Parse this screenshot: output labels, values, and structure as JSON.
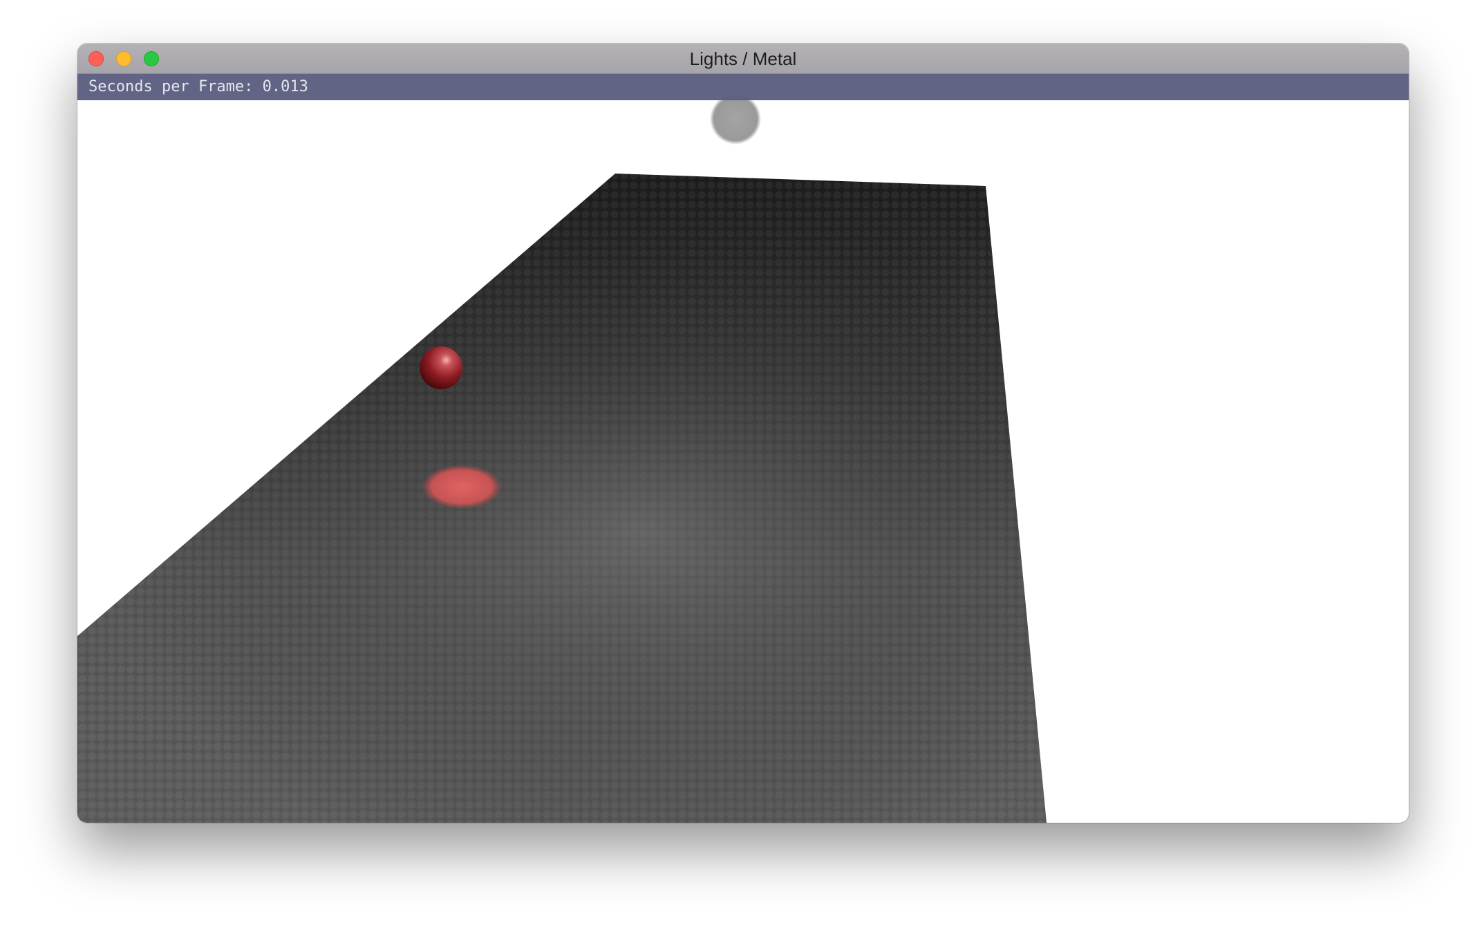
{
  "window": {
    "title": "Lights / Metal"
  },
  "overlay": {
    "stats_text": "Seconds per Frame: 0.013"
  },
  "scene": {
    "background_color": "#ffffff",
    "floor_color": "#4a4a4a",
    "sphere_color": "#8e1c22",
    "light_spot_color": "#e05a5a",
    "overhead_light_color": "#9a9a9a"
  },
  "traffic_lights": {
    "close_color": "#fe5f57",
    "minimize_color": "#febc2e",
    "maximize_color": "#28c840"
  }
}
